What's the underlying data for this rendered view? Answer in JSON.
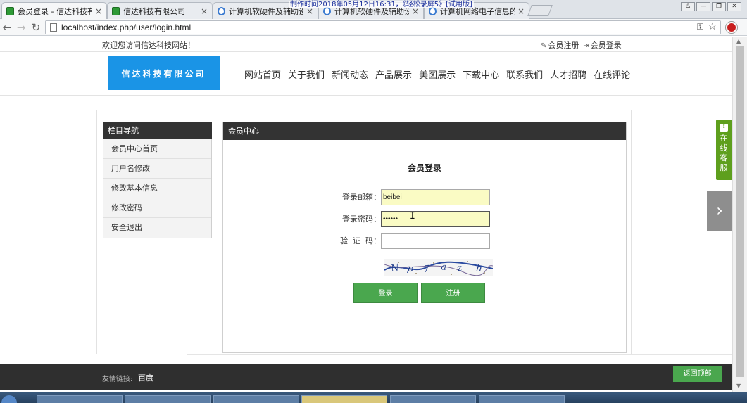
{
  "browser": {
    "tabs": [
      {
        "label": "会员登录 - 信达科技有限",
        "icon": "green-page-icon"
      },
      {
        "label": "信达科技有限公司",
        "icon": "green-page-icon"
      },
      {
        "label": "计算机软硬件及辅助设备",
        "icon": "globe-icon"
      },
      {
        "label": "计算机软硬件及辅助设备",
        "icon": "globe-icon"
      },
      {
        "label": "计算机网络电子信息的拦",
        "icon": "globe-icon"
      }
    ],
    "tab_close": "×",
    "recording_banner": "制作时间2018年05月12日16:31，《轻松录屏5》[试用版]",
    "url": "localhost/index.php/user/login.html",
    "window_controls": [
      "♙",
      "—",
      "❐",
      "✕"
    ]
  },
  "topbar": {
    "welcome": "欢迎您访问信达科技网站！",
    "register": "会员注册",
    "login": "会员登录"
  },
  "header": {
    "logo": "信达科技有限公司",
    "nav": [
      "网站首页",
      "关于我们",
      "新闻动态",
      "产品展示",
      "美图展示",
      "下载中心",
      "联系我们",
      "人才招聘",
      "在线评论"
    ]
  },
  "sidebar": {
    "title": "栏目导航",
    "items": [
      "会员中心首页",
      "用户名修改",
      "修改基本信息",
      "修改密码",
      "安全退出"
    ]
  },
  "main": {
    "title": "会员中心",
    "form_title": "会员登录",
    "email_label": "登录邮箱：",
    "email_value": "beibei",
    "password_label": "登录密码：",
    "password_value": "••••••",
    "captcha_label": "验  证  码：",
    "captcha_value": "",
    "login_button": "登录",
    "register_button": "注册"
  },
  "footer": {
    "links_label": "友情链接:",
    "link": "百度",
    "back_to_top": "返回顶部"
  },
  "service": {
    "text": [
      "在",
      "线",
      "客",
      "服"
    ]
  },
  "colors": {
    "logo_bg": "#1a94e6",
    "accent_green": "#4aa74e",
    "dark_bar": "#333333",
    "footer_bg": "#2f2f2f",
    "autofill_yellow": "#fafbc4",
    "service_green": "#5e9f1d"
  }
}
